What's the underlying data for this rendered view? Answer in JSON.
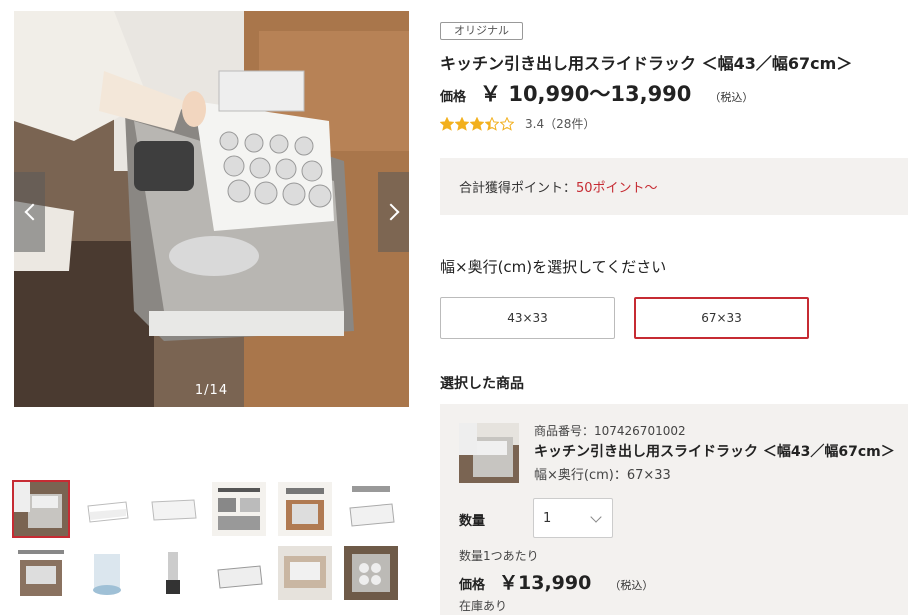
{
  "gallery": {
    "counter": "1/14",
    "main_image_icon": "kitchen-drawer-rack-photo",
    "thumbnail_count": 12
  },
  "product": {
    "badge": "オリジナル",
    "title": "キッチン引き出し用スライドラック ＜幅43／幅67cm＞",
    "price_label": "価格",
    "price_value": "￥ 10,990〜13,990",
    "tax_note": "（税込）",
    "rating_value": 3.4,
    "rating_text": "3.4（28件）"
  },
  "points": {
    "label": "合計獲得ポイント：",
    "value": "50ポイント〜"
  },
  "size_selector": {
    "heading": "幅×奥行(cm)を選択してください",
    "options": [
      "43×33",
      "67×33"
    ],
    "selected": "67×33"
  },
  "selected_item": {
    "heading": "選択した商品",
    "code": "商品番号：107426701002",
    "name": "キッチン引き出し用スライドラック ＜幅43／幅67cm＞",
    "spec": "幅×奥行(cm)：67×33",
    "qty_label": "数量",
    "qty_value": "1",
    "per_unit": "数量1つあたり",
    "price_label": "価格",
    "price_value": "￥13,990",
    "tax_note": "（税込）",
    "stock": "在庫あり"
  },
  "colors": {
    "accent": "#c62b33",
    "panel_bg": "#f3f1ef",
    "star": "#f2b01e"
  }
}
